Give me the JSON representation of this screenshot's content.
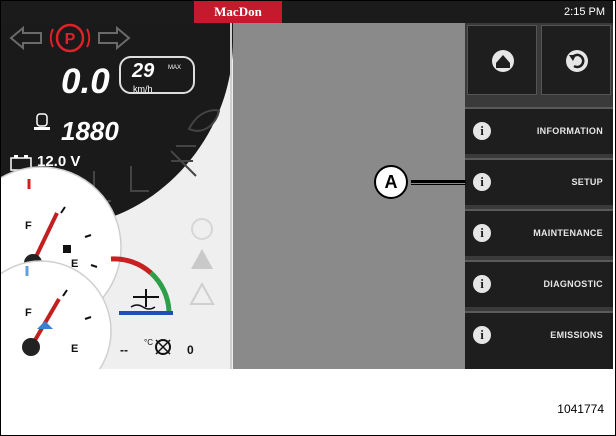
{
  "header": {
    "brand": "MacDon",
    "time": "2:15 PM"
  },
  "dashboard": {
    "speed_value": "0.0",
    "speed_limit": "29",
    "speed_limit_tag": "MAX",
    "speed_unit": "km/h",
    "engine_rpm": "1880",
    "voltage": "12.0 V",
    "fuel_full_label": "F",
    "fuel_empty_label": "E",
    "def_full_label": "F",
    "def_empty_label": "E",
    "coolant_temp_text": "--",
    "temp_unit": "°C",
    "fan_reverse_count": "0"
  },
  "menu": {
    "home_icon": "home-icon",
    "back_icon": "back-icon",
    "items": [
      {
        "label": "INFORMATION",
        "icon": "info-icon"
      },
      {
        "label": "SETUP",
        "icon": "info-icon"
      },
      {
        "label": "MAINTENANCE",
        "icon": "info-icon"
      },
      {
        "label": "DIAGNOSTIC",
        "icon": "info-icon"
      },
      {
        "label": "EMISSIONS",
        "icon": "info-icon"
      }
    ]
  },
  "callout": {
    "letter": "A"
  },
  "figure_number": "1041774",
  "colors": {
    "brand_red": "#c5192d",
    "parking_brake_red": "#e0202a",
    "menu_dark": "#1e1e1e"
  }
}
